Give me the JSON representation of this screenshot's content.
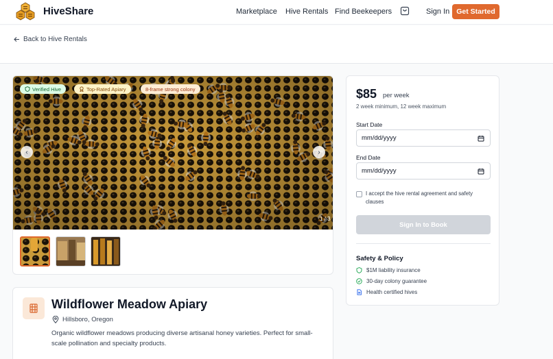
{
  "header": {
    "brand": "HiveShare",
    "nav": [
      "Marketplace",
      "Hive Rentals",
      "Find Beekeepers"
    ],
    "cart_icon": "shopping-bag-icon",
    "sign_in": "Sign In",
    "get_started": "Get Started",
    "accent_color": "#e0692e"
  },
  "breadcrumb": {
    "back_label": "Back to Hive Rentals"
  },
  "gallery": {
    "badges": [
      {
        "label": "Verified Hive",
        "icon": "shield-icon",
        "color": "#166534",
        "bg": "#dcfce7"
      },
      {
        "label": "Top-Rated Apiary",
        "icon": "award-icon",
        "color": "#854d0e",
        "bg": "#fef3c7"
      },
      {
        "label": "8-frame strong colony",
        "icon": "",
        "color": "#9a3412",
        "bg": "#ffedd5"
      }
    ],
    "counter": "1 / 3",
    "active_thumb": 0
  },
  "booking": {
    "price": "$85",
    "per": "per week",
    "minimum": "2 week minimum, 12 week maximum",
    "start_label": "Start Date",
    "start_value": "mm/dd/yyyy",
    "end_label": "End Date",
    "end_value": "mm/dd/yyyy",
    "agreement": "I accept the hive rental agreement and safety clauses",
    "book_button": "Sign In to Book",
    "safety_title": "Safety & Policy",
    "safety_items": [
      {
        "label": "$1M liability insurance",
        "icon": "shield-icon"
      },
      {
        "label": "30-day colony guarantee",
        "icon": "check-circle-icon"
      },
      {
        "label": "Health certified hives",
        "icon": "document-icon"
      }
    ]
  },
  "listing": {
    "title": "Wildflower Meadow Apiary",
    "location": "Hillsboro, Oregon",
    "description": "Organic wildflower meadows producing diverse artisanal honey varieties. Perfect for small-scale pollination and specialty products."
  }
}
